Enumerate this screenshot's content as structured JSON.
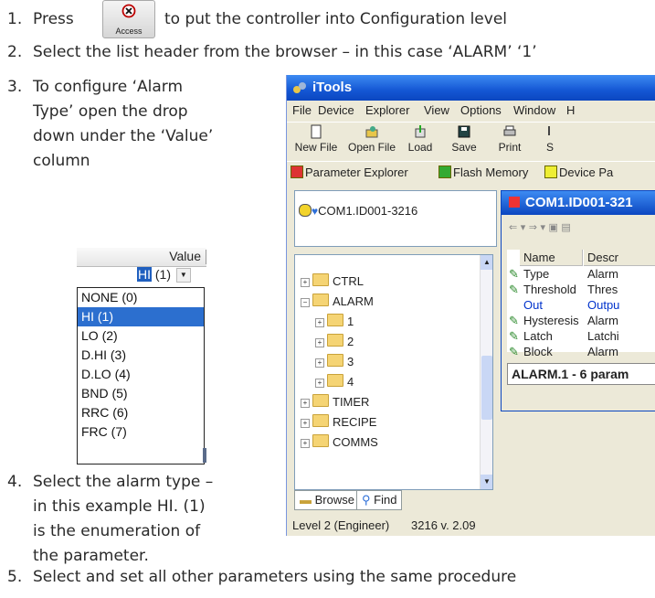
{
  "steps": [
    {
      "num": "1.",
      "pre": "Press",
      "post": "to put the controller into Configuration level"
    },
    {
      "num": "2.",
      "text": "Select the list header from the browser – in this case ‘ALARM’ ‘1’"
    },
    {
      "num": "3.",
      "lines": [
        "To configure ‘Alarm",
        "Type’ open the drop",
        "down under the ‘Value’",
        "column"
      ]
    },
    {
      "num": "4.",
      "lines": [
        "Select the alarm type –",
        "in this example HI.  (1)",
        "is the enumeration of",
        "the parameter."
      ]
    },
    {
      "num": "5.",
      "text": "Select and set all other parameters using the same procedure"
    }
  ],
  "access_button": {
    "label": "Access",
    "icon": "access-icon"
  },
  "dropdown": {
    "header": "Value",
    "selected_value": "HI (1)",
    "options": [
      "NONE (0)",
      "HI (1)",
      "LO (2)",
      "D.HI (3)",
      "D.LO (4)",
      "BND (5)",
      "RRC (6)",
      "FRC (7)"
    ],
    "selected_index": 1
  },
  "itools": {
    "title": "iTools",
    "menu": [
      "File",
      "Device",
      "Explorer",
      "View",
      "Options",
      "Window",
      "H"
    ],
    "toolbar": [
      "New File",
      "Open File",
      "Load",
      "Save",
      "Print",
      "S"
    ],
    "toolbar2": [
      "Parameter Explorer",
      "Flash Memory",
      "Device Pa"
    ],
    "device": "COM1.ID001-3216",
    "tree": [
      {
        "label": "CTRL",
        "level": 0
      },
      {
        "label": "ALARM",
        "level": 0,
        "open": true
      },
      {
        "label": "1",
        "level": 1
      },
      {
        "label": "2",
        "level": 1
      },
      {
        "label": "3",
        "level": 1
      },
      {
        "label": "4",
        "level": 1
      },
      {
        "label": "TIMER",
        "level": 0
      },
      {
        "label": "RECIPE",
        "level": 0
      },
      {
        "label": "COMMS",
        "level": 0
      }
    ],
    "tabs": [
      "Browse",
      "Find"
    ],
    "child_title": "COM1.ID001-321",
    "columns": [
      "Name",
      "Descr"
    ],
    "rows": [
      {
        "name": "Type",
        "desc": "Alarm"
      },
      {
        "name": "Threshold",
        "desc": "Thres"
      },
      {
        "name": "Out",
        "desc": "Outpu"
      },
      {
        "name": "Hysteresis",
        "desc": "Alarm"
      },
      {
        "name": "Latch",
        "desc": "Latchi"
      },
      {
        "name": "Block",
        "desc": "Alarm"
      }
    ],
    "param_summary": "ALARM.1 - 6 param",
    "status": [
      "Level 2 (Engineer)",
      "3216 v. 2.09"
    ],
    "colors": {
      "title_blue": "#1457d4",
      "pencil_green": "#2e8b2e",
      "link_blue": "#0033cc"
    }
  }
}
